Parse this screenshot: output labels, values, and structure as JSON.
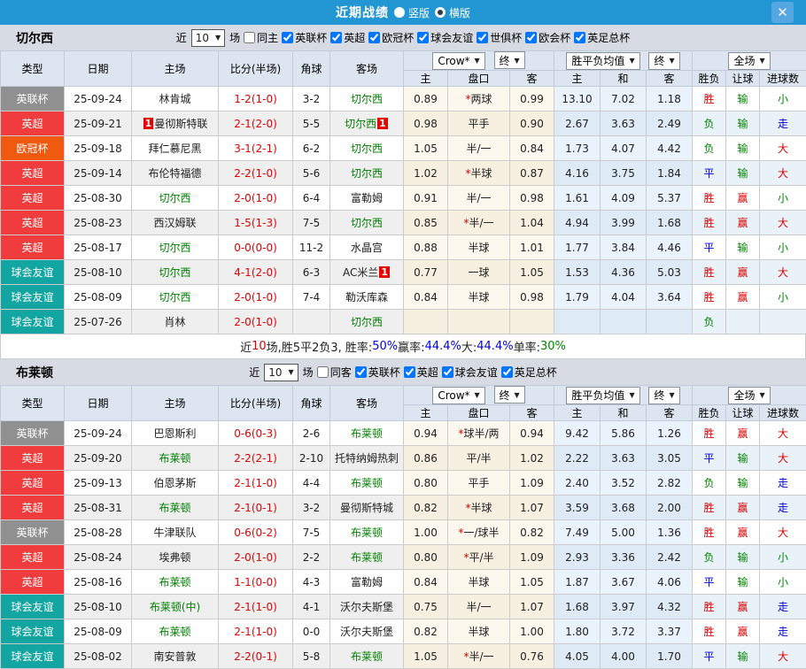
{
  "ui": {
    "dropdown_arrow": "▼",
    "close_icon": "✕"
  },
  "colors": {
    "titlebar": "#2196d3",
    "close_button": "#54a7e0",
    "competition": {
      "英联杯": "#909090",
      "英超": "#f03c3c",
      "欧冠杯": "#f05a10",
      "球会友谊": "#13a5a2"
    },
    "result_red": "#dd0000",
    "result_green": "#008800",
    "result_blue": "#0000dd",
    "self_team_green": "#008000",
    "score_red": "#e60000"
  },
  "titlebar": {
    "title": "近期战绩",
    "options": [
      {
        "label": "竖版",
        "selected": false
      },
      {
        "label": "横版",
        "selected": true
      }
    ]
  },
  "table_headers": {
    "cols": [
      "类型",
      "日期",
      "主场",
      "比分(半场)",
      "角球",
      "客场"
    ],
    "sub": [
      "主",
      "盘口",
      "客",
      "主",
      "和",
      "客",
      "胜负",
      "让球",
      "进球数"
    ],
    "bookmaker": "Crow*",
    "final": "终",
    "avg": "胜平负均值",
    "final2": "终",
    "scope": "全场"
  },
  "sections": [
    {
      "team": "切尔西",
      "filter": {
        "recent": "近",
        "count": "10",
        "unit": "场",
        "same": "同主",
        "same_checked": false,
        "leagues": [
          {
            "label": "英联杯",
            "checked": true
          },
          {
            "label": "英超",
            "checked": true
          },
          {
            "label": "欧冠杯",
            "checked": true
          },
          {
            "label": "球会友谊",
            "checked": true
          },
          {
            "label": "世俱杯",
            "checked": true
          },
          {
            "label": "欧会杯",
            "checked": true
          },
          {
            "label": "英足总杯",
            "checked": true
          }
        ]
      },
      "rows": [
        {
          "comp": "英联杯",
          "date": "25-09-24",
          "home": {
            "name": "林肯城"
          },
          "score": "1-2(1-0)",
          "corner": "3-2",
          "away": {
            "name": "切尔西",
            "self": true
          },
          "odds": {
            "home": "0.89",
            "handicap": {
              "star": true,
              "text": "两球"
            },
            "away": "0.99"
          },
          "avg": {
            "home": "13.10",
            "draw": "7.02",
            "away": "1.18"
          },
          "result": {
            "outcome": [
              "胜",
              "red"
            ],
            "let": [
              "输",
              "green"
            ],
            "goal": [
              "小",
              "green"
            ]
          }
        },
        {
          "comp": "英超",
          "date": "25-09-21",
          "home": {
            "name": "曼彻斯特联",
            "badge_before": "1"
          },
          "score": "2-1(2-0)",
          "corner": "5-5",
          "away": {
            "name": "切尔西",
            "self": true,
            "badge_after": "1"
          },
          "odds": {
            "home": "0.98",
            "handicap": {
              "star": false,
              "text": "平手"
            },
            "away": "0.90"
          },
          "avg": {
            "home": "2.67",
            "draw": "3.63",
            "away": "2.49"
          },
          "result": {
            "outcome": [
              "负",
              "green"
            ],
            "let": [
              "输",
              "green"
            ],
            "goal": [
              "走",
              "blue"
            ]
          }
        },
        {
          "comp": "欧冠杯",
          "date": "25-09-18",
          "home": {
            "name": "拜仁慕尼黑"
          },
          "score": "3-1(2-1)",
          "corner": "6-2",
          "away": {
            "name": "切尔西",
            "self": true
          },
          "odds": {
            "home": "1.05",
            "handicap": {
              "star": false,
              "text": "半/一"
            },
            "away": "0.84"
          },
          "avg": {
            "home": "1.73",
            "draw": "4.07",
            "away": "4.42"
          },
          "result": {
            "outcome": [
              "负",
              "green"
            ],
            "let": [
              "输",
              "green"
            ],
            "goal": [
              "大",
              "red"
            ]
          }
        },
        {
          "comp": "英超",
          "date": "25-09-14",
          "home": {
            "name": "布伦特福德"
          },
          "score": "2-2(1-0)",
          "corner": "5-6",
          "away": {
            "name": "切尔西",
            "self": true
          },
          "odds": {
            "home": "1.02",
            "handicap": {
              "star": true,
              "text": "半球"
            },
            "away": "0.87"
          },
          "avg": {
            "home": "4.16",
            "draw": "3.75",
            "away": "1.84"
          },
          "result": {
            "outcome": [
              "平",
              "blue"
            ],
            "let": [
              "输",
              "green"
            ],
            "goal": [
              "大",
              "red"
            ]
          }
        },
        {
          "comp": "英超",
          "date": "25-08-30",
          "home": {
            "name": "切尔西",
            "self": true
          },
          "score": "2-0(1-0)",
          "corner": "6-4",
          "away": {
            "name": "富勒姆"
          },
          "odds": {
            "home": "0.91",
            "handicap": {
              "star": false,
              "text": "半/一"
            },
            "away": "0.98"
          },
          "avg": {
            "home": "1.61",
            "draw": "4.09",
            "away": "5.37"
          },
          "result": {
            "outcome": [
              "胜",
              "red"
            ],
            "let": [
              "赢",
              "red"
            ],
            "goal": [
              "小",
              "green"
            ]
          }
        },
        {
          "comp": "英超",
          "date": "25-08-23",
          "home": {
            "name": "西汉姆联"
          },
          "score": "1-5(1-3)",
          "corner": "7-5",
          "away": {
            "name": "切尔西",
            "self": true
          },
          "odds": {
            "home": "0.85",
            "handicap": {
              "star": true,
              "text": "半/一"
            },
            "away": "1.04"
          },
          "avg": {
            "home": "4.94",
            "draw": "3.99",
            "away": "1.68"
          },
          "result": {
            "outcome": [
              "胜",
              "red"
            ],
            "let": [
              "赢",
              "red"
            ],
            "goal": [
              "大",
              "red"
            ]
          }
        },
        {
          "comp": "英超",
          "date": "25-08-17",
          "home": {
            "name": "切尔西",
            "self": true
          },
          "score": "0-0(0-0)",
          "corner": "11-2",
          "away": {
            "name": "水晶宫"
          },
          "odds": {
            "home": "0.88",
            "handicap": {
              "star": false,
              "text": "半球"
            },
            "away": "1.01"
          },
          "avg": {
            "home": "1.77",
            "draw": "3.84",
            "away": "4.46"
          },
          "result": {
            "outcome": [
              "平",
              "blue"
            ],
            "let": [
              "输",
              "green"
            ],
            "goal": [
              "小",
              "green"
            ]
          }
        },
        {
          "comp": "球会友谊",
          "date": "25-08-10",
          "home": {
            "name": "切尔西",
            "self": true
          },
          "score": "4-1(2-0)",
          "corner": "6-3",
          "away": {
            "name": "AC米兰",
            "badge_after": "1"
          },
          "odds": {
            "home": "0.77",
            "handicap": {
              "star": false,
              "text": "一球"
            },
            "away": "1.05"
          },
          "avg": {
            "home": "1.53",
            "draw": "4.36",
            "away": "5.03"
          },
          "result": {
            "outcome": [
              "胜",
              "red"
            ],
            "let": [
              "赢",
              "red"
            ],
            "goal": [
              "大",
              "red"
            ]
          }
        },
        {
          "comp": "球会友谊",
          "date": "25-08-09",
          "home": {
            "name": "切尔西",
            "self": true
          },
          "score": "2-0(1-0)",
          "corner": "7-4",
          "away": {
            "name": "勒沃库森"
          },
          "odds": {
            "home": "0.84",
            "handicap": {
              "star": false,
              "text": "半球"
            },
            "away": "0.98"
          },
          "avg": {
            "home": "1.79",
            "draw": "4.04",
            "away": "3.64"
          },
          "result": {
            "outcome": [
              "胜",
              "red"
            ],
            "let": [
              "赢",
              "red"
            ],
            "goal": [
              "小",
              "green"
            ]
          }
        },
        {
          "comp": "球会友谊",
          "date": "25-07-26",
          "home": {
            "name": "肖林"
          },
          "score": "2-0(1-0)",
          "corner": "",
          "away": {
            "name": "切尔西",
            "self": true
          },
          "odds": {
            "home": "",
            "handicap": null,
            "away": ""
          },
          "avg": {
            "home": "",
            "draw": "",
            "away": ""
          },
          "result": {
            "outcome": [
              "负",
              "green"
            ],
            "let": null,
            "goal": null
          }
        }
      ],
      "summary": [
        [
          "近",
          "black"
        ],
        [
          "10",
          "red"
        ],
        [
          "场,胜5平2负3, 胜率:",
          "black"
        ],
        [
          "50%",
          "blue"
        ],
        [
          " 赢率:",
          "black"
        ],
        [
          "44.4%",
          "blue"
        ],
        [
          " 大:",
          "black"
        ],
        [
          "44.4%",
          "blue"
        ],
        [
          " 单率:",
          "black"
        ],
        [
          "30%",
          "green"
        ]
      ]
    },
    {
      "team": "布莱顿",
      "filter": {
        "recent": "近",
        "count": "10",
        "unit": "场",
        "same": "同客",
        "same_checked": false,
        "leagues": [
          {
            "label": "英联杯",
            "checked": true
          },
          {
            "label": "英超",
            "checked": true
          },
          {
            "label": "球会友谊",
            "checked": true
          },
          {
            "label": "英足总杯",
            "checked": true
          }
        ]
      },
      "rows": [
        {
          "comp": "英联杯",
          "date": "25-09-24",
          "home": {
            "name": "巴恩斯利"
          },
          "score": "0-6(0-3)",
          "corner": "2-6",
          "away": {
            "name": "布莱顿",
            "self": true
          },
          "odds": {
            "home": "0.94",
            "handicap": {
              "star": true,
              "text": "球半/两"
            },
            "away": "0.94"
          },
          "avg": {
            "home": "9.42",
            "draw": "5.86",
            "away": "1.26"
          },
          "result": {
            "outcome": [
              "胜",
              "red"
            ],
            "let": [
              "赢",
              "red"
            ],
            "goal": [
              "大",
              "red"
            ]
          }
        },
        {
          "comp": "英超",
          "date": "25-09-20",
          "home": {
            "name": "布莱顿",
            "self": true
          },
          "score": "2-2(2-1)",
          "corner": "2-10",
          "away": {
            "name": "托特纳姆热刺"
          },
          "odds": {
            "home": "0.86",
            "handicap": {
              "star": false,
              "text": "平/半"
            },
            "away": "1.02"
          },
          "avg": {
            "home": "2.22",
            "draw": "3.63",
            "away": "3.05"
          },
          "result": {
            "outcome": [
              "平",
              "blue"
            ],
            "let": [
              "输",
              "green"
            ],
            "goal": [
              "大",
              "red"
            ]
          }
        },
        {
          "comp": "英超",
          "date": "25-09-13",
          "home": {
            "name": "伯恩茅斯"
          },
          "score": "2-1(1-0)",
          "corner": "4-4",
          "away": {
            "name": "布莱顿",
            "self": true
          },
          "odds": {
            "home": "0.80",
            "handicap": {
              "star": false,
              "text": "平手"
            },
            "away": "1.09"
          },
          "avg": {
            "home": "2.40",
            "draw": "3.52",
            "away": "2.82"
          },
          "result": {
            "outcome": [
              "负",
              "green"
            ],
            "let": [
              "输",
              "green"
            ],
            "goal": [
              "走",
              "blue"
            ]
          }
        },
        {
          "comp": "英超",
          "date": "25-08-31",
          "home": {
            "name": "布莱顿",
            "self": true
          },
          "score": "2-1(0-1)",
          "corner": "3-2",
          "away": {
            "name": "曼彻斯特城"
          },
          "odds": {
            "home": "0.82",
            "handicap": {
              "star": true,
              "text": "半球"
            },
            "away": "1.07"
          },
          "avg": {
            "home": "3.59",
            "draw": "3.68",
            "away": "2.00"
          },
          "result": {
            "outcome": [
              "胜",
              "red"
            ],
            "let": [
              "赢",
              "red"
            ],
            "goal": [
              "走",
              "blue"
            ]
          }
        },
        {
          "comp": "英联杯",
          "date": "25-08-28",
          "home": {
            "name": "牛津联队"
          },
          "score": "0-6(0-2)",
          "corner": "7-5",
          "away": {
            "name": "布莱顿",
            "self": true
          },
          "odds": {
            "home": "1.00",
            "handicap": {
              "star": true,
              "text": "一/球半"
            },
            "away": "0.82"
          },
          "avg": {
            "home": "7.49",
            "draw": "5.00",
            "away": "1.36"
          },
          "result": {
            "outcome": [
              "胜",
              "red"
            ],
            "let": [
              "赢",
              "red"
            ],
            "goal": [
              "大",
              "red"
            ]
          }
        },
        {
          "comp": "英超",
          "date": "25-08-24",
          "home": {
            "name": "埃弗顿"
          },
          "score": "2-0(1-0)",
          "corner": "2-2",
          "away": {
            "name": "布莱顿",
            "self": true
          },
          "odds": {
            "home": "0.80",
            "handicap": {
              "star": true,
              "text": "平/半"
            },
            "away": "1.09"
          },
          "avg": {
            "home": "2.93",
            "draw": "3.36",
            "away": "2.42"
          },
          "result": {
            "outcome": [
              "负",
              "green"
            ],
            "let": [
              "输",
              "green"
            ],
            "goal": [
              "小",
              "green"
            ]
          }
        },
        {
          "comp": "英超",
          "date": "25-08-16",
          "home": {
            "name": "布莱顿",
            "self": true
          },
          "score": "1-1(0-0)",
          "corner": "4-3",
          "away": {
            "name": "富勒姆"
          },
          "odds": {
            "home": "0.84",
            "handicap": {
              "star": false,
              "text": "半球"
            },
            "away": "1.05"
          },
          "avg": {
            "home": "1.87",
            "draw": "3.67",
            "away": "4.06"
          },
          "result": {
            "outcome": [
              "平",
              "blue"
            ],
            "let": [
              "输",
              "green"
            ],
            "goal": [
              "小",
              "green"
            ]
          }
        },
        {
          "comp": "球会友谊",
          "date": "25-08-10",
          "home": {
            "name": "布莱顿(中)",
            "self": true
          },
          "score": "2-1(1-0)",
          "corner": "4-1",
          "away": {
            "name": "沃尔夫斯堡"
          },
          "odds": {
            "home": "0.75",
            "handicap": {
              "star": false,
              "text": "半/一"
            },
            "away": "1.07"
          },
          "avg": {
            "home": "1.68",
            "draw": "3.97",
            "away": "4.32"
          },
          "result": {
            "outcome": [
              "胜",
              "red"
            ],
            "let": [
              "赢",
              "red"
            ],
            "goal": [
              "走",
              "blue"
            ]
          }
        },
        {
          "comp": "球会友谊",
          "date": "25-08-09",
          "home": {
            "name": "布莱顿",
            "self": true
          },
          "score": "2-1(1-0)",
          "corner": "0-0",
          "away": {
            "name": "沃尔夫斯堡"
          },
          "odds": {
            "home": "0.82",
            "handicap": {
              "star": false,
              "text": "半球"
            },
            "away": "1.00"
          },
          "avg": {
            "home": "1.80",
            "draw": "3.72",
            "away": "3.37"
          },
          "result": {
            "outcome": [
              "胜",
              "red"
            ],
            "let": [
              "赢",
              "red"
            ],
            "goal": [
              "走",
              "blue"
            ]
          }
        },
        {
          "comp": "球会友谊",
          "date": "25-08-02",
          "home": {
            "name": "南安普敦"
          },
          "score": "2-2(0-1)",
          "corner": "5-8",
          "away": {
            "name": "布莱顿",
            "self": true
          },
          "odds": {
            "home": "1.05",
            "handicap": {
              "star": true,
              "text": "半/一"
            },
            "away": "0.76"
          },
          "avg": {
            "home": "4.05",
            "draw": "4.00",
            "away": "1.70"
          },
          "result": {
            "outcome": [
              "平",
              "blue"
            ],
            "let": [
              "输",
              "green"
            ],
            "goal": [
              "大",
              "red"
            ]
          }
        }
      ],
      "summary": null
    }
  ]
}
